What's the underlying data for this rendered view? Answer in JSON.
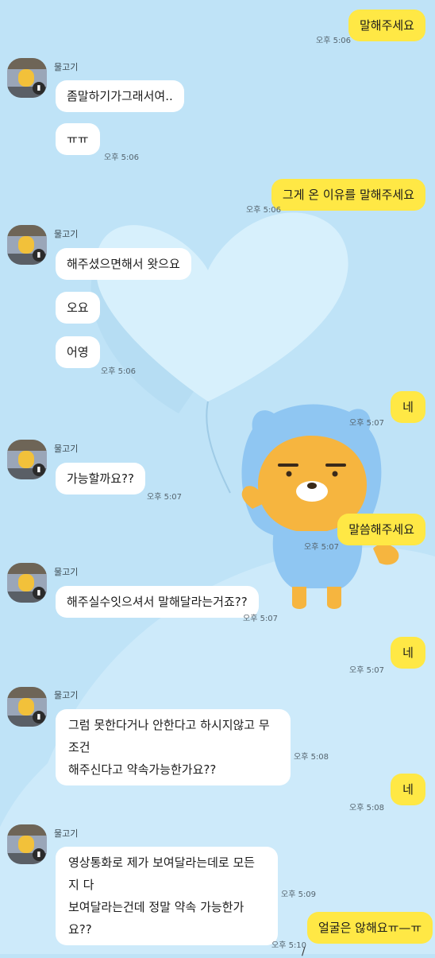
{
  "colors": {
    "background": "#bfe3f7",
    "incoming_bubble": "#ffffff",
    "outgoing_bubble": "#ffe845",
    "heart": "#d7f0fc",
    "character_body": "#f6b53f",
    "character_hood": "#8fc6f2"
  },
  "sender": {
    "name": "물고기",
    "avatar_icon": "profile-photo-pooh",
    "badge_icon": "menu-badge-icon"
  },
  "background_art": {
    "icons": [
      "heart-balloon-icon",
      "ryan-character-hoodie-icon"
    ]
  },
  "messages": {
    "m1": {
      "text": "말해주세요",
      "time": "오후 5:06"
    },
    "g1": {
      "name": "물고기"
    },
    "m2": {
      "text": "좀말하기가그래서여.."
    },
    "m3": {
      "text": "ㅠㅠ",
      "time": "오후 5:06"
    },
    "m4": {
      "text": "그게 온 이유를 말해주세요",
      "time": "오후 5:06"
    },
    "g2": {
      "name": "물고기"
    },
    "m5": {
      "text": "해주셨으면해서 왓으요"
    },
    "m6": {
      "text": "오요"
    },
    "m7": {
      "text": "어영",
      "time": "오후 5:06"
    },
    "m8": {
      "text": "네",
      "time": "오후 5:07"
    },
    "g3": {
      "name": "물고기"
    },
    "m9": {
      "text": "가능할까요??",
      "time": "오후 5:07"
    },
    "m10": {
      "text": "말씀해주세요",
      "time": "오후 5:07"
    },
    "g4": {
      "name": "물고기"
    },
    "m11": {
      "text": "해주실수잇으셔서 말해달라는거죠??",
      "time": "오후 5:07"
    },
    "m12": {
      "text": "네",
      "time": "오후 5:07"
    },
    "g5": {
      "name": "물고기"
    },
    "m13": {
      "line1": "그럼 못한다거나 안한다고 하시지않고 무조건",
      "line2": "해주신다고 약속가능한가요??",
      "time": "오후 5:08"
    },
    "m14": {
      "text": "네",
      "time": "오후 5:08"
    },
    "g6": {
      "name": "물고기"
    },
    "m15": {
      "line1": "영상통화로 제가 보여달라는데로 모든지 다",
      "line2": "보여달라는건데 정말 약속 가능한가요??",
      "time": "오후 5:09"
    },
    "m16": {
      "text": "얼굴은 않해요ㅠ—ㅠ",
      "time": "오후 5:10",
      "quote_mark": "/"
    }
  }
}
